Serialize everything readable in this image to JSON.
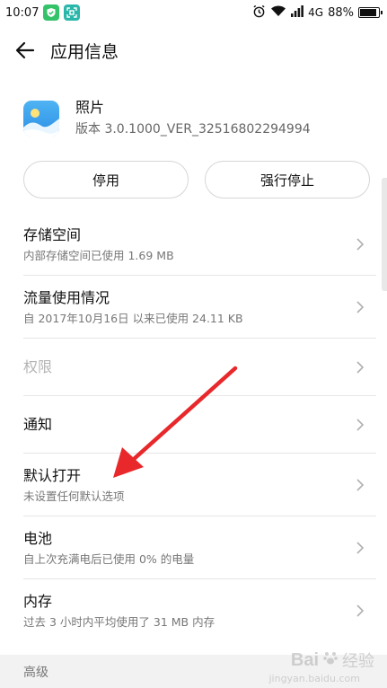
{
  "status_bar": {
    "time": "10:07",
    "network": "4G",
    "battery_percent": "88%",
    "battery_level": 0.88
  },
  "header": {
    "title": "应用信息"
  },
  "app": {
    "name": "照片",
    "version": "版本 3.0.1000_VER_32516802294994"
  },
  "buttons": {
    "disable": "停用",
    "force_stop": "强行停止"
  },
  "settings": [
    {
      "title": "存储空间",
      "subtitle": "内部存储空间已使用 1.69 MB"
    },
    {
      "title": "流量使用情况",
      "subtitle": "自 2017年10月16日 以来已使用 24.11 KB"
    },
    {
      "title": "权限",
      "subtitle": ""
    },
    {
      "title": "通知",
      "subtitle": ""
    },
    {
      "title": "默认打开",
      "subtitle": "未设置任何默认选项"
    },
    {
      "title": "电池",
      "subtitle": "自上次充满电后已使用 0% 的电量"
    },
    {
      "title": "内存",
      "subtitle": "过去 3 小时内平均使用了 31 MB 内存"
    }
  ],
  "section_advanced": "高级",
  "watermark": {
    "brand": "Bai",
    "brand_suffix": "经验",
    "url": "jingyan.baidu.com"
  },
  "colors": {
    "annotation_arrow": "#e8282a",
    "disabled_text": "#b4b4b4",
    "app_icon": "#3aa3ef"
  },
  "icons": [
    "shield-icon",
    "scan-icon",
    "alarm-icon",
    "wifi-icon",
    "signal-icon",
    "battery-icon",
    "back-arrow-icon",
    "photos-app-icon",
    "chevron-right-icon"
  ]
}
